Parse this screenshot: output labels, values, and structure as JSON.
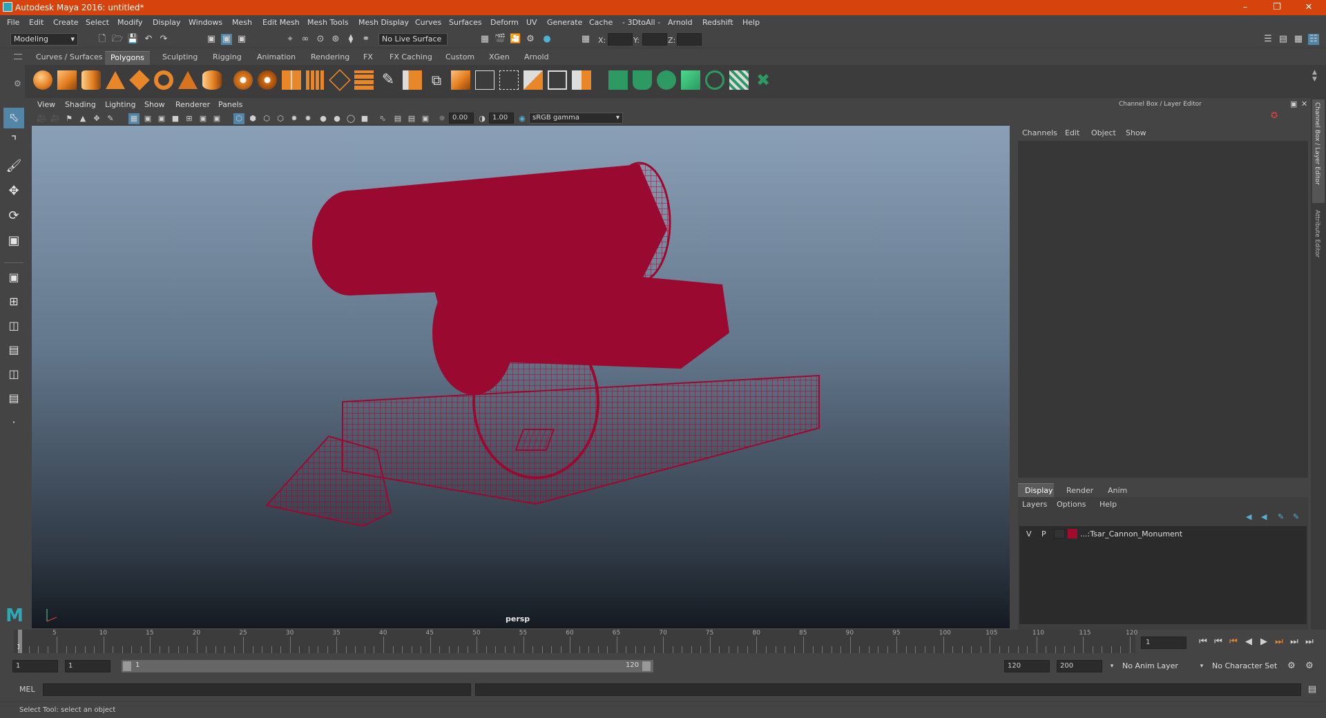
{
  "window": {
    "title": "Autodesk Maya 2016: untitled*"
  },
  "menubar": [
    "File",
    "Edit",
    "Create",
    "Select",
    "Modify",
    "Display",
    "Windows",
    "Mesh",
    "Edit Mesh",
    "Mesh Tools",
    "Mesh Display",
    "Curves",
    "Surfaces",
    "Deform",
    "UV",
    "Generate",
    "Cache",
    "- 3DtoAll -",
    "Arnold",
    "Redshift",
    "Help"
  ],
  "status_line": {
    "mode": "Modeling",
    "live_surface": "No Live Surface",
    "x_label": "X:",
    "y_label": "Y:",
    "z_label": "Z:"
  },
  "shelf_tabs": [
    "Curves / Surfaces",
    "Polygons",
    "Sculpting",
    "Rigging",
    "Animation",
    "Rendering",
    "FX",
    "FX Caching",
    "Custom",
    "XGen",
    "Arnold"
  ],
  "shelf_active": "Polygons",
  "viewport": {
    "menu": [
      "View",
      "Shading",
      "Lighting",
      "Show",
      "Renderer",
      "Panels"
    ],
    "exposure": "0.00",
    "gamma": "1.00",
    "color_space": "sRGB gamma",
    "camera": "persp",
    "wire_color": "#9a0a30"
  },
  "channel_box": {
    "title": "Channel Box / Layer Editor",
    "menu": [
      "Channels",
      "Edit",
      "Object",
      "Show"
    ]
  },
  "layer_editor": {
    "tabs": [
      "Display",
      "Render",
      "Anim"
    ],
    "active_tab": "Display",
    "menu": [
      "Layers",
      "Options",
      "Help"
    ],
    "layers": [
      {
        "v": "V",
        "p": "P",
        "color": "#a00c2c",
        "name": "...:Tsar_Cannon_Monument"
      }
    ]
  },
  "side_tabs": [
    "Channel Box / Layer Editor",
    "Attribute Editor"
  ],
  "time_slider": {
    "ticks": [
      "5",
      "10",
      "15",
      "20",
      "25",
      "30",
      "35",
      "40",
      "45",
      "50",
      "55",
      "60",
      "65",
      "70",
      "75",
      "80",
      "85",
      "90",
      "95",
      "100",
      "105",
      "110",
      "115",
      "120"
    ],
    "first": "1",
    "current_frame": "1"
  },
  "range_slider": {
    "start": "1",
    "playback_start": "1",
    "slider_start": "1",
    "slider_end": "120",
    "playback_end": "120",
    "end": "200",
    "anim_layer": "No Anim Layer",
    "character_set": "No Character Set"
  },
  "command_line": {
    "label": "MEL"
  },
  "help_line": {
    "text": "Select Tool: select an object"
  }
}
